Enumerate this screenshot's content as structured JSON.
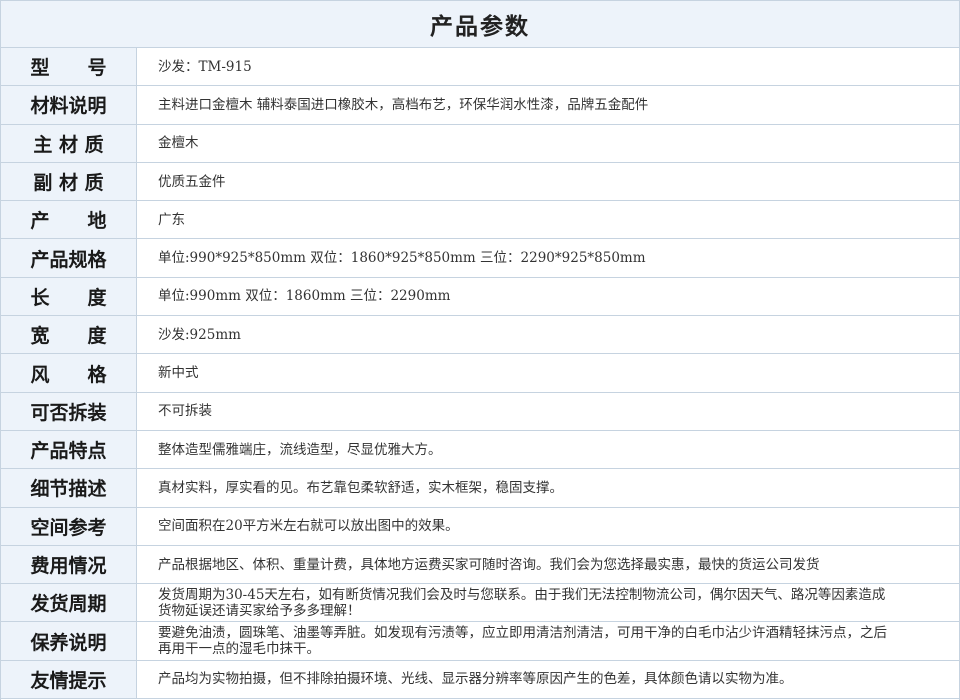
{
  "title": "产品参数",
  "rows": [
    {
      "label": "型　　号",
      "value": "沙发：TM-915"
    },
    {
      "label": "材料说明",
      "value": "主料进口金檀木 辅料泰国进口橡胶木，高档布艺，环保华润水性漆，品牌五金配件"
    },
    {
      "label": "主 材 质",
      "value": "金檀木"
    },
    {
      "label": "副 材 质",
      "value": "优质五金件"
    },
    {
      "label": "产　　地",
      "value": "广东"
    },
    {
      "label": "产品规格",
      "value": "单位:990*925*850mm  双位：1860*925*850mm 三位：2290*925*850mm"
    },
    {
      "label": "长　　度",
      "value": "单位:990mm  双位：1860mm  三位：2290mm"
    },
    {
      "label": "宽　　度",
      "value": "沙发:925mm"
    },
    {
      "label": "风　　格",
      "value": "新中式"
    },
    {
      "label": "可否拆装",
      "value": "不可拆装"
    },
    {
      "label": "产品特点",
      "value": "整体造型儒雅端庄，流线造型，尽显优雅大方。"
    },
    {
      "label": "细节描述",
      "value": "真材实料，厚实看的见。布艺靠包柔软舒适，实木框架，稳固支撑。"
    },
    {
      "label": "空间参考",
      "value": "空间面积在20平方米左右就可以放出图中的效果。"
    },
    {
      "label": "费用情况",
      "value": "产品根据地区、体积、重量计费，具体地方运费买家可随时咨询。我们会为您选择最实惠，最快的货运公司发货"
    },
    {
      "label": "发货周期",
      "value": "发货周期为30-45天左右，如有断货情况我们会及时与您联系。由于我们无法控制物流公司，偶尔因天气、路况等因素造成货物延误还请买家给予多多理解！"
    },
    {
      "label": "保养说明",
      "value": "要避免油渍，圆珠笔、油墨等弄脏。如发现有污渍等，应立即用清洁剂清洁，可用干净的白毛巾沾少许酒精轻抹污点，之后再用干一点的湿毛巾抹干。"
    },
    {
      "label": "友情提示",
      "value": "产品均为实物拍摄，但不排除拍摄环境、光线、显示器分辨率等原因产生的色差，具体颜色请以实物为准。"
    }
  ]
}
